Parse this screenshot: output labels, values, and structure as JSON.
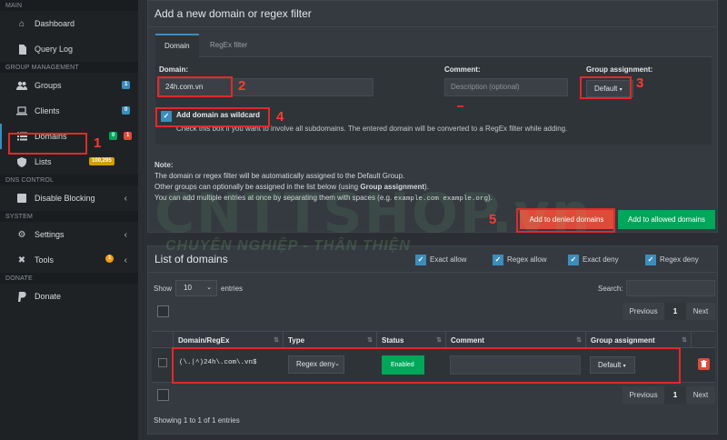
{
  "sidebar": {
    "sections": {
      "main": "MAIN",
      "group_mgmt": "GROUP MANAGEMENT",
      "dns_control": "DNS CONTROL",
      "system": "SYSTEM",
      "donate": "DONATE"
    },
    "items": {
      "dashboard": "Dashboard",
      "query_log": "Query Log",
      "groups": "Groups",
      "groups_badge": "1",
      "clients": "Clients",
      "clients_badge": "0",
      "domains": "Domains",
      "domains_badge_green": "0",
      "domains_badge_red": "1",
      "lists": "Lists",
      "lists_badge": "100,295",
      "disable_blocking": "Disable Blocking",
      "settings": "Settings",
      "tools": "Tools",
      "tools_badge": "1",
      "donate": "Donate"
    }
  },
  "add_panel": {
    "title": "Add a new domain or regex filter",
    "tabs": [
      "Domain",
      "RegEx filter"
    ],
    "domain_label": "Domain:",
    "domain_value": "24h.com.vn",
    "comment_label": "Comment:",
    "comment_placeholder": "Description (optional)",
    "group_label": "Group assignment:",
    "group_value": "Default",
    "wildcard_label": "Add domain as wildcard",
    "wildcard_help": "Check this box if you want to involve all subdomains. The entered domain will be converted to a RegEx filter while adding.",
    "note_title": "Note:",
    "note_line1": "The domain or regex filter will be automatically assigned to the Default Group.",
    "note_line2_pre": "Other groups can optionally be assigned in the list below (using ",
    "note_line2_bold": "Group assignment",
    "note_line2_post": ").",
    "note_line3_pre": "You can add multiple entries at once by separating them with spaces (e.g. ",
    "note_line3_code": "example.com example.org",
    "note_line3_post": ").",
    "deny_button": "Add to denied domains",
    "allow_button": "Add to allowed domains"
  },
  "list_panel": {
    "title": "List of domains",
    "filters": [
      "Exact allow",
      "Regex allow",
      "Exact deny",
      "Regex deny"
    ],
    "show_label": "Show",
    "show_value": "10",
    "entries_label": "entries",
    "search_label": "Search:",
    "previous": "Previous",
    "page": "1",
    "next": "Next",
    "columns": [
      "Domain/RegEx",
      "Type",
      "Status",
      "Comment",
      "Group assignment"
    ],
    "rows": [
      {
        "domain": "(\\.|^)24h\\.com\\.vn$",
        "type": "Regex deny",
        "status": "Enabled",
        "comment": "",
        "group": "Default"
      }
    ],
    "footer_info": "Showing 1 to 1 of 1 entries"
  },
  "annotations": [
    "1",
    "2",
    "3",
    "4",
    "5"
  ],
  "watermark": {
    "brand": "CNTTSHOP.vn",
    "slogan": "CHUYÊN NGHIỆP - THÂN THIỆN"
  },
  "colors": {
    "accent": "#3c8dbc",
    "danger": "#dd4b39",
    "success": "#00a65a",
    "annotation": "#e02a2a"
  }
}
